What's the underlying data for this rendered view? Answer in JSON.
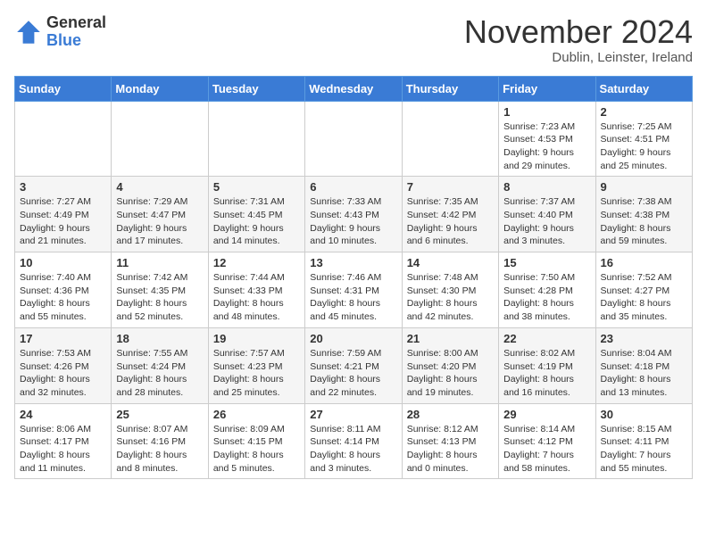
{
  "logo": {
    "general": "General",
    "blue": "Blue"
  },
  "title": "November 2024",
  "subtitle": "Dublin, Leinster, Ireland",
  "days_header": [
    "Sunday",
    "Monday",
    "Tuesday",
    "Wednesday",
    "Thursday",
    "Friday",
    "Saturday"
  ],
  "weeks": [
    [
      {
        "day": "",
        "info": ""
      },
      {
        "day": "",
        "info": ""
      },
      {
        "day": "",
        "info": ""
      },
      {
        "day": "",
        "info": ""
      },
      {
        "day": "",
        "info": ""
      },
      {
        "day": "1",
        "info": "Sunrise: 7:23 AM\nSunset: 4:53 PM\nDaylight: 9 hours\nand 29 minutes."
      },
      {
        "day": "2",
        "info": "Sunrise: 7:25 AM\nSunset: 4:51 PM\nDaylight: 9 hours\nand 25 minutes."
      }
    ],
    [
      {
        "day": "3",
        "info": "Sunrise: 7:27 AM\nSunset: 4:49 PM\nDaylight: 9 hours\nand 21 minutes."
      },
      {
        "day": "4",
        "info": "Sunrise: 7:29 AM\nSunset: 4:47 PM\nDaylight: 9 hours\nand 17 minutes."
      },
      {
        "day": "5",
        "info": "Sunrise: 7:31 AM\nSunset: 4:45 PM\nDaylight: 9 hours\nand 14 minutes."
      },
      {
        "day": "6",
        "info": "Sunrise: 7:33 AM\nSunset: 4:43 PM\nDaylight: 9 hours\nand 10 minutes."
      },
      {
        "day": "7",
        "info": "Sunrise: 7:35 AM\nSunset: 4:42 PM\nDaylight: 9 hours\nand 6 minutes."
      },
      {
        "day": "8",
        "info": "Sunrise: 7:37 AM\nSunset: 4:40 PM\nDaylight: 9 hours\nand 3 minutes."
      },
      {
        "day": "9",
        "info": "Sunrise: 7:38 AM\nSunset: 4:38 PM\nDaylight: 8 hours\nand 59 minutes."
      }
    ],
    [
      {
        "day": "10",
        "info": "Sunrise: 7:40 AM\nSunset: 4:36 PM\nDaylight: 8 hours\nand 55 minutes."
      },
      {
        "day": "11",
        "info": "Sunrise: 7:42 AM\nSunset: 4:35 PM\nDaylight: 8 hours\nand 52 minutes."
      },
      {
        "day": "12",
        "info": "Sunrise: 7:44 AM\nSunset: 4:33 PM\nDaylight: 8 hours\nand 48 minutes."
      },
      {
        "day": "13",
        "info": "Sunrise: 7:46 AM\nSunset: 4:31 PM\nDaylight: 8 hours\nand 45 minutes."
      },
      {
        "day": "14",
        "info": "Sunrise: 7:48 AM\nSunset: 4:30 PM\nDaylight: 8 hours\nand 42 minutes."
      },
      {
        "day": "15",
        "info": "Sunrise: 7:50 AM\nSunset: 4:28 PM\nDaylight: 8 hours\nand 38 minutes."
      },
      {
        "day": "16",
        "info": "Sunrise: 7:52 AM\nSunset: 4:27 PM\nDaylight: 8 hours\nand 35 minutes."
      }
    ],
    [
      {
        "day": "17",
        "info": "Sunrise: 7:53 AM\nSunset: 4:26 PM\nDaylight: 8 hours\nand 32 minutes."
      },
      {
        "day": "18",
        "info": "Sunrise: 7:55 AM\nSunset: 4:24 PM\nDaylight: 8 hours\nand 28 minutes."
      },
      {
        "day": "19",
        "info": "Sunrise: 7:57 AM\nSunset: 4:23 PM\nDaylight: 8 hours\nand 25 minutes."
      },
      {
        "day": "20",
        "info": "Sunrise: 7:59 AM\nSunset: 4:21 PM\nDaylight: 8 hours\nand 22 minutes."
      },
      {
        "day": "21",
        "info": "Sunrise: 8:00 AM\nSunset: 4:20 PM\nDaylight: 8 hours\nand 19 minutes."
      },
      {
        "day": "22",
        "info": "Sunrise: 8:02 AM\nSunset: 4:19 PM\nDaylight: 8 hours\nand 16 minutes."
      },
      {
        "day": "23",
        "info": "Sunrise: 8:04 AM\nSunset: 4:18 PM\nDaylight: 8 hours\nand 13 minutes."
      }
    ],
    [
      {
        "day": "24",
        "info": "Sunrise: 8:06 AM\nSunset: 4:17 PM\nDaylight: 8 hours\nand 11 minutes."
      },
      {
        "day": "25",
        "info": "Sunrise: 8:07 AM\nSunset: 4:16 PM\nDaylight: 8 hours\nand 8 minutes."
      },
      {
        "day": "26",
        "info": "Sunrise: 8:09 AM\nSunset: 4:15 PM\nDaylight: 8 hours\nand 5 minutes."
      },
      {
        "day": "27",
        "info": "Sunrise: 8:11 AM\nSunset: 4:14 PM\nDaylight: 8 hours\nand 3 minutes."
      },
      {
        "day": "28",
        "info": "Sunrise: 8:12 AM\nSunset: 4:13 PM\nDaylight: 8 hours\nand 0 minutes."
      },
      {
        "day": "29",
        "info": "Sunrise: 8:14 AM\nSunset: 4:12 PM\nDaylight: 7 hours\nand 58 minutes."
      },
      {
        "day": "30",
        "info": "Sunrise: 8:15 AM\nSunset: 4:11 PM\nDaylight: 7 hours\nand 55 minutes."
      }
    ]
  ]
}
